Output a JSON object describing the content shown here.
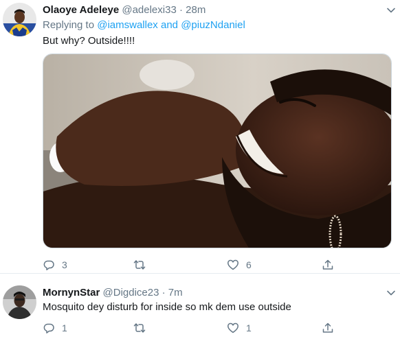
{
  "tweets": [
    {
      "name": "Olaoye Adeleye",
      "handle": "@adelexi33",
      "dot": "·",
      "time": "28m",
      "replying_prefix": "Replying to",
      "replying_user1": "@iamswallex",
      "replying_and": "and",
      "replying_user2": "@piuzNdaniel",
      "text": "But why? Outside!!!!",
      "has_media": true,
      "replies": "3",
      "retweets": "",
      "likes": "6"
    },
    {
      "name": "MornynStar",
      "handle": "@Digdice23",
      "dot": "·",
      "time": "7m",
      "text": "Mosquito dey disturb for inside so mk dem use outside",
      "replies": "1",
      "retweets": "",
      "likes": "1"
    }
  ],
  "colors": {
    "accent": "#1da1f2",
    "secondary_text": "#657786",
    "border": "#e6ecf0"
  },
  "icons": [
    "chevron-down-icon",
    "reply-icon",
    "retweet-icon",
    "like-icon",
    "share-icon"
  ]
}
